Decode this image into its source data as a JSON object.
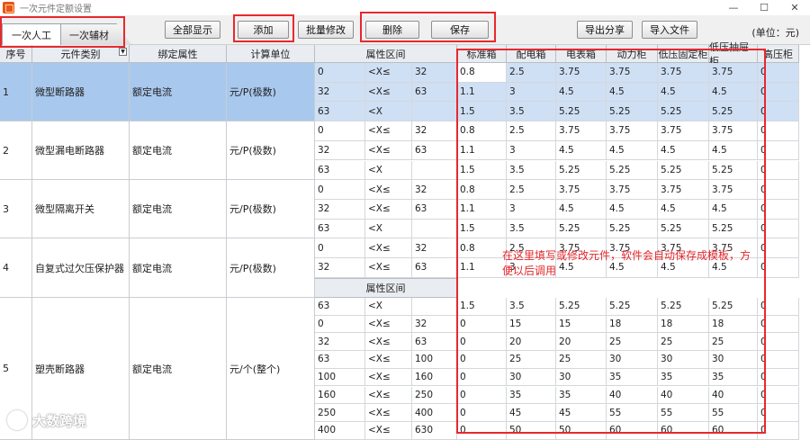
{
  "window": {
    "title": "一次元件定额设置",
    "minimize": "—",
    "maximize": "☐",
    "close": "✕"
  },
  "tabs": [
    {
      "label": "一次人工"
    },
    {
      "label": "一次辅材"
    }
  ],
  "toolbar": {
    "show_all": "全部显示",
    "add": "添加",
    "batch_edit": "批量修改",
    "delete": "删除",
    "save": "保存",
    "export_share": "导出分享",
    "import_file": "导入文件",
    "unit": "(单位：元)"
  },
  "left_table": {
    "columns": [
      "序号",
      "元件类别",
      "绑定属性",
      "计算单位"
    ],
    "rows": [
      {
        "no": "1",
        "category": "微型断路器",
        "attr": "额定电流",
        "unit": "元/P(极数)"
      },
      {
        "no": "2",
        "category": "微型漏电断路器",
        "attr": "额定电流",
        "unit": "元/P(极数)"
      },
      {
        "no": "3",
        "category": "微型隔离开关",
        "attr": "额定电流",
        "unit": "元/P(极数)"
      },
      {
        "no": "4",
        "category": "自复式过欠压保护器",
        "attr": "额定电流",
        "unit": "元/P(极数)"
      },
      {
        "no": "5",
        "category": "塑壳断路器",
        "attr": "额定电流",
        "unit": "元/个(整个)"
      }
    ]
  },
  "right_table": {
    "columns": [
      "属性区间",
      "标准箱",
      "配电箱",
      "电表箱",
      "动力柜",
      "低压固定柜",
      "低压抽屉柜",
      "高压柜"
    ],
    "rows_a": [
      [
        "0",
        "<X≤",
        "32",
        "0.8",
        "2.5",
        "3.75",
        "3.75",
        "3.75",
        "3.75",
        "0"
      ],
      [
        "32",
        "<X≤",
        "63",
        "1.1",
        "3",
        "4.5",
        "4.5",
        "4.5",
        "4.5",
        "0"
      ],
      [
        "63",
        "<X",
        "",
        "1.5",
        "3.5",
        "5.25",
        "5.25",
        "5.25",
        "5.25",
        "0"
      ],
      [
        "0",
        "<X≤",
        "32",
        "0.8",
        "2.5",
        "3.75",
        "3.75",
        "3.75",
        "3.75",
        "0"
      ],
      [
        "32",
        "<X≤",
        "63",
        "1.1",
        "3",
        "4.5",
        "4.5",
        "4.5",
        "4.5",
        "0"
      ],
      [
        "63",
        "<X",
        "",
        "1.5",
        "3.5",
        "5.25",
        "5.25",
        "5.25",
        "5.25",
        "0"
      ],
      [
        "0",
        "<X≤",
        "32",
        "0.8",
        "2.5",
        "3.75",
        "3.75",
        "3.75",
        "3.75",
        "0"
      ],
      [
        "32",
        "<X≤",
        "63",
        "1.1",
        "3",
        "4.5",
        "4.5",
        "4.5",
        "4.5",
        "0"
      ],
      [
        "63",
        "<X",
        "",
        "1.5",
        "3.5",
        "5.25",
        "5.25",
        "5.25",
        "5.25",
        "0"
      ],
      [
        "0",
        "<X≤",
        "32",
        "0.8",
        "2.5",
        "3.75",
        "3.75",
        "3.75",
        "3.75",
        "0"
      ],
      [
        "32",
        "<X≤",
        "63",
        "1.1",
        "3",
        "4.5",
        "4.5",
        "4.5",
        "4.5",
        "0"
      ]
    ],
    "rows_b": [
      [
        "63",
        "<X",
        "",
        "1.5",
        "3.5",
        "5.25",
        "5.25",
        "5.25",
        "5.25",
        "0"
      ],
      [
        "0",
        "<X≤",
        "32",
        "0",
        "15",
        "15",
        "18",
        "18",
        "18",
        "0"
      ],
      [
        "32",
        "<X≤",
        "63",
        "0",
        "20",
        "20",
        "25",
        "25",
        "25",
        "0"
      ],
      [
        "63",
        "<X≤",
        "100",
        "0",
        "25",
        "25",
        "30",
        "30",
        "30",
        "0"
      ],
      [
        "100",
        "<X≤",
        "160",
        "0",
        "30",
        "30",
        "35",
        "35",
        "35",
        "0"
      ],
      [
        "160",
        "<X≤",
        "250",
        "0",
        "35",
        "35",
        "40",
        "40",
        "40",
        "0"
      ],
      [
        "250",
        "<X≤",
        "400",
        "0",
        "45",
        "45",
        "55",
        "55",
        "55",
        "0"
      ],
      [
        "400",
        "<X≤",
        "630",
        "0",
        "50",
        "50",
        "60",
        "60",
        "60",
        "0"
      ]
    ]
  },
  "annotation": "在这里填写或修改元件，软件会自动保存成模板，方便以后调用",
  "watermark": "大数跨境"
}
